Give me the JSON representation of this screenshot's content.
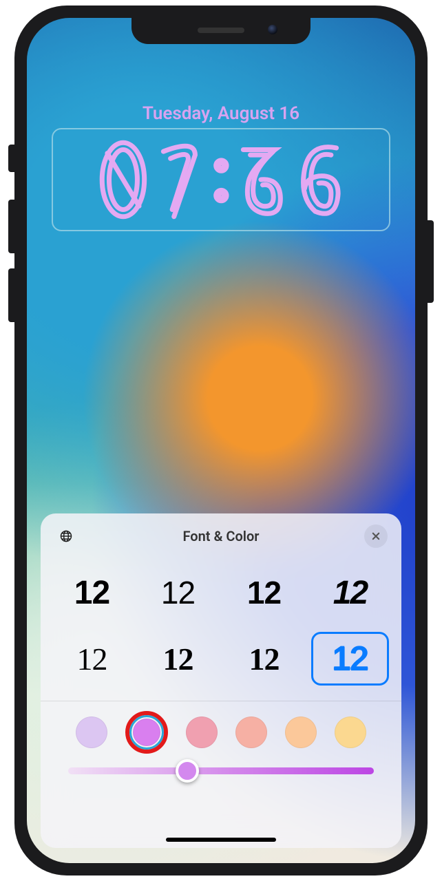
{
  "lock": {
    "date": "Tuesday, August 16",
    "time": "07:36"
  },
  "panel": {
    "title": "Font & Color",
    "font_options": [
      {
        "label": "12",
        "style": "f1",
        "selected": false
      },
      {
        "label": "12",
        "style": "f2",
        "selected": false
      },
      {
        "label": "12",
        "style": "f3",
        "selected": false
      },
      {
        "label": "12",
        "style": "f4",
        "selected": false
      },
      {
        "label": "12",
        "style": "f5",
        "selected": false
      },
      {
        "label": "12",
        "style": "f6",
        "selected": false
      },
      {
        "label": "12",
        "style": "f7",
        "selected": false
      },
      {
        "label": "12",
        "style": "outline",
        "selected": true
      }
    ],
    "colors": [
      {
        "hex": "#dcc6f2",
        "selected": false,
        "highlighted": false
      },
      {
        "hex": "#d97fef",
        "selected": true,
        "highlighted": true
      },
      {
        "hex": "#f0a0b0",
        "selected": false,
        "highlighted": false
      },
      {
        "hex": "#f6b0a4",
        "selected": false,
        "highlighted": false
      },
      {
        "hex": "#fbc89a",
        "selected": false,
        "highlighted": false
      },
      {
        "hex": "#fbd890",
        "selected": false,
        "highlighted": false
      }
    ],
    "slider_value": 0.39
  }
}
